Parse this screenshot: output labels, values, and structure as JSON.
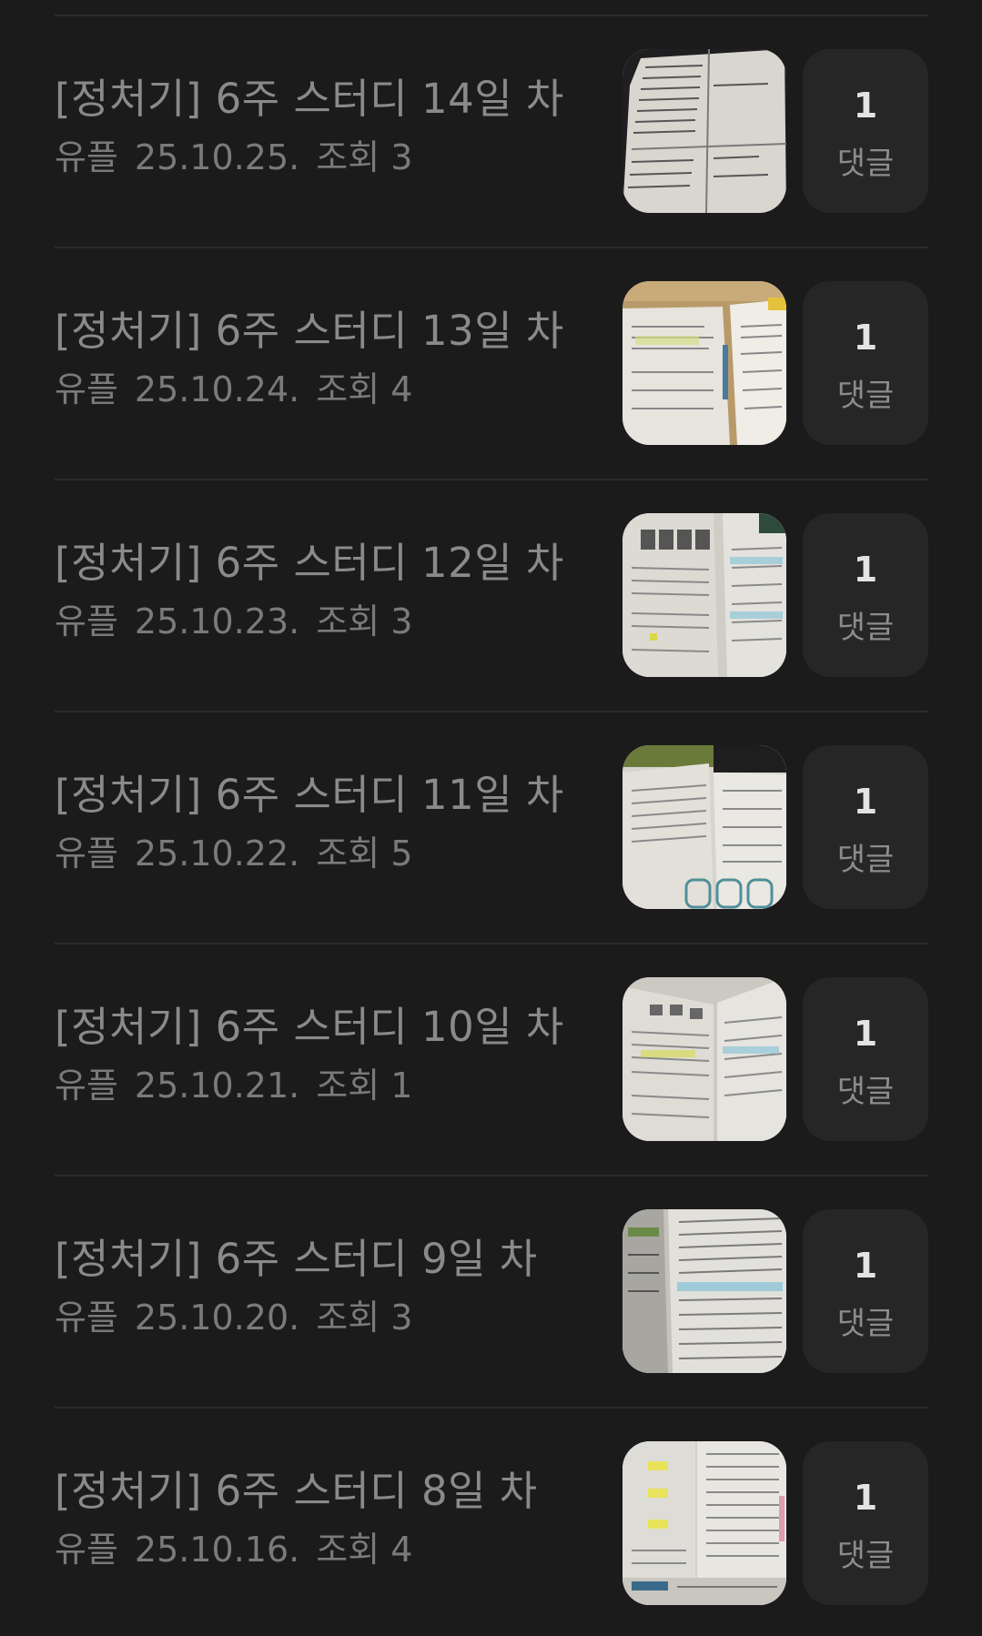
{
  "posts": [
    {
      "title": "[정처기] 6주 스터디 14일 차",
      "author": "유플",
      "date": "25.10.25.",
      "views": "조회 3",
      "comment_count": "1",
      "comment_label": "댓글",
      "thumbnail": "handwritten-notes-photo"
    },
    {
      "title": "[정처기] 6주 스터디 13일 차",
      "author": "유플",
      "date": "25.10.24.",
      "views": "조회 4",
      "comment_count": "1",
      "comment_label": "댓글",
      "thumbnail": "desk-with-papers-photo"
    },
    {
      "title": "[정처기] 6주 스터디 12일 차",
      "author": "유플",
      "date": "25.10.23.",
      "views": "조회 3",
      "comment_count": "1",
      "comment_label": "댓글",
      "thumbnail": "open-textbook-photo"
    },
    {
      "title": "[정처기] 6주 스터디 11일 차",
      "author": "유플",
      "date": "25.10.22.",
      "views": "조회 5",
      "comment_count": "1",
      "comment_label": "댓글",
      "thumbnail": "open-textbook-photo"
    },
    {
      "title": "[정처기] 6주 스터디 10일 차",
      "author": "유플",
      "date": "25.10.21.",
      "views": "조회 1",
      "comment_count": "1",
      "comment_label": "댓글",
      "thumbnail": "open-textbook-photo"
    },
    {
      "title": "[정처기] 6주 스터디 9일 차",
      "author": "유플",
      "date": "25.10.20.",
      "views": "조회 3",
      "comment_count": "1",
      "comment_label": "댓글",
      "thumbnail": "open-textbook-photo"
    },
    {
      "title": "[정처기] 6주 스터디 8일 차",
      "author": "유플",
      "date": "25.10.16.",
      "views": "조회 4",
      "comment_count": "1",
      "comment_label": "댓글",
      "thumbnail": "open-textbook-photo"
    }
  ],
  "colors": {
    "background": "#1b1b1b",
    "divider": "#2b2b2b",
    "title_text": "#8a8a8a",
    "meta_text": "#7a7a7a",
    "comment_box": "#262626",
    "comment_count": "#e3e3e3"
  }
}
